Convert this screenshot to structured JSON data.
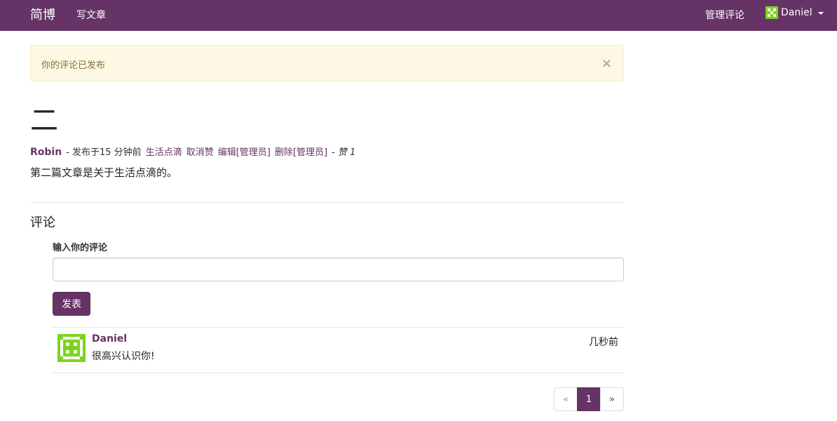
{
  "navbar": {
    "brand": "简博",
    "write_label": "写文章",
    "manage_comments_label": "管理评论",
    "user_name": "Daniel"
  },
  "alert": {
    "message": "你的评论已发布",
    "close": "×"
  },
  "post": {
    "title": "二",
    "author": "Robin",
    "published": "- 发布于15 分钟前",
    "category": "生活点滴",
    "unlike": "取消赞",
    "edit": "编辑[管理员]",
    "delete": "删除[管理员]",
    "likes_prefix": "- 赞",
    "likes_count": "1",
    "body": "第二篇文章是关于生活点滴的。"
  },
  "comments": {
    "title": "评论",
    "input_label": "输入你的评论",
    "input_value": "",
    "submit_label": "发表",
    "items": [
      {
        "author": "Daniel",
        "text": "很高兴认识你!",
        "time": "几秒前"
      }
    ]
  },
  "pagination": {
    "prev": "«",
    "pages": [
      "1"
    ],
    "next": "»",
    "current": "1"
  },
  "colors": {
    "brand": "#653366",
    "alert_bg": "#fcf8e3",
    "alert_text": "#8a6d3b",
    "identicon": "#7ed321"
  }
}
